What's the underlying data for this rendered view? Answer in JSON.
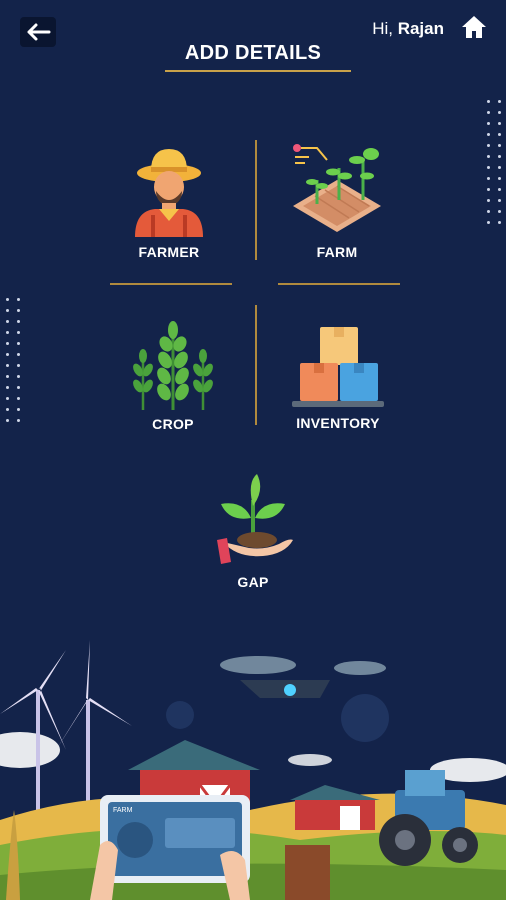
{
  "header": {
    "greeting": "Hi,",
    "user_name": "Rajan",
    "title": "ADD DETAILS"
  },
  "menu": {
    "farmer": "FARMER",
    "farm": "FARM",
    "crop": "CROP",
    "inventory": "INVENTORY",
    "gap": "GAP"
  },
  "illustration": {
    "tablet_label": "FARM"
  },
  "colors": {
    "background": "#13234a",
    "accent": "#c9a24a"
  }
}
